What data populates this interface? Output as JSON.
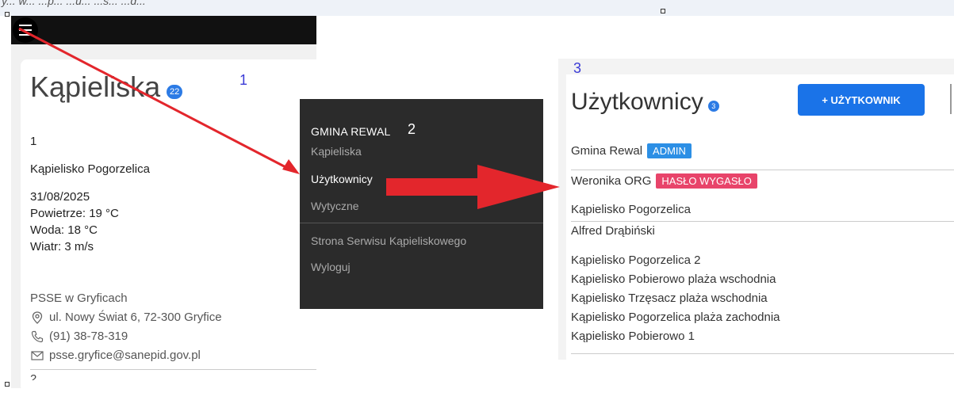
{
  "caption": "y... w... ...p... ...u... ...s... ...d...",
  "left": {
    "title": "Kąpieliska",
    "count": "22",
    "step_label": "1",
    "item_number": "1",
    "item_name": "Kąpielisko Pogorzelica",
    "date": "31/08/2025",
    "air": "Powietrze: 19 °C",
    "water": "Woda: 18 °C",
    "wind": "Wiatr: 3 m/s",
    "org": "PSSE w Gryficach",
    "address": "ul. Nowy Świat 6, 72-300 Gryfice",
    "phone": "(91) 38-78-319",
    "email": "psse.gryfice@sanepid.gov.pl",
    "next_number": "2",
    "icons": {
      "menu": "hamburger-icon",
      "address": "location-pin-icon",
      "phone": "phone-icon",
      "email": "envelope-icon"
    }
  },
  "menu": {
    "header": "GMINA REWAL",
    "step_label": "2",
    "items": [
      "Kąpieliska",
      "Użytkownicy",
      "Wytyczne"
    ],
    "active": "Użytkownicy",
    "extra_items": [
      "Strona Serwisu Kąpieliskowego",
      "Wyloguj"
    ]
  },
  "right": {
    "step_label": "3",
    "title": "Użytkownicy",
    "count": "3",
    "add_button": "+ UŻYTKOWNIK",
    "users": [
      {
        "name": "Gmina Rewal",
        "tag": "ADMIN"
      },
      {
        "name": "Weronika ORG",
        "tag": "HASŁO WYGASŁO"
      }
    ],
    "user_details": [
      "Kąpielisko Pogorzelica",
      "Alfred Drąbiński"
    ],
    "bathing_areas": [
      "Kąpielisko Pogorzelica 2",
      "Kąpielisko Pobierowo plaża wschodnia",
      "Kąpielisko Trzęsacz plaża wschodnia",
      "Kąpielisko Pogorzelica plaża zachodnia",
      "Kąpielisko Pobierowo 1"
    ]
  },
  "colors": {
    "accent_blue": "#1a73e8",
    "admin_tag": "#2c8fe5",
    "expired_tag": "#e8446a",
    "arrow_red": "#e3262c",
    "menu_bg": "#2b2b2b"
  }
}
